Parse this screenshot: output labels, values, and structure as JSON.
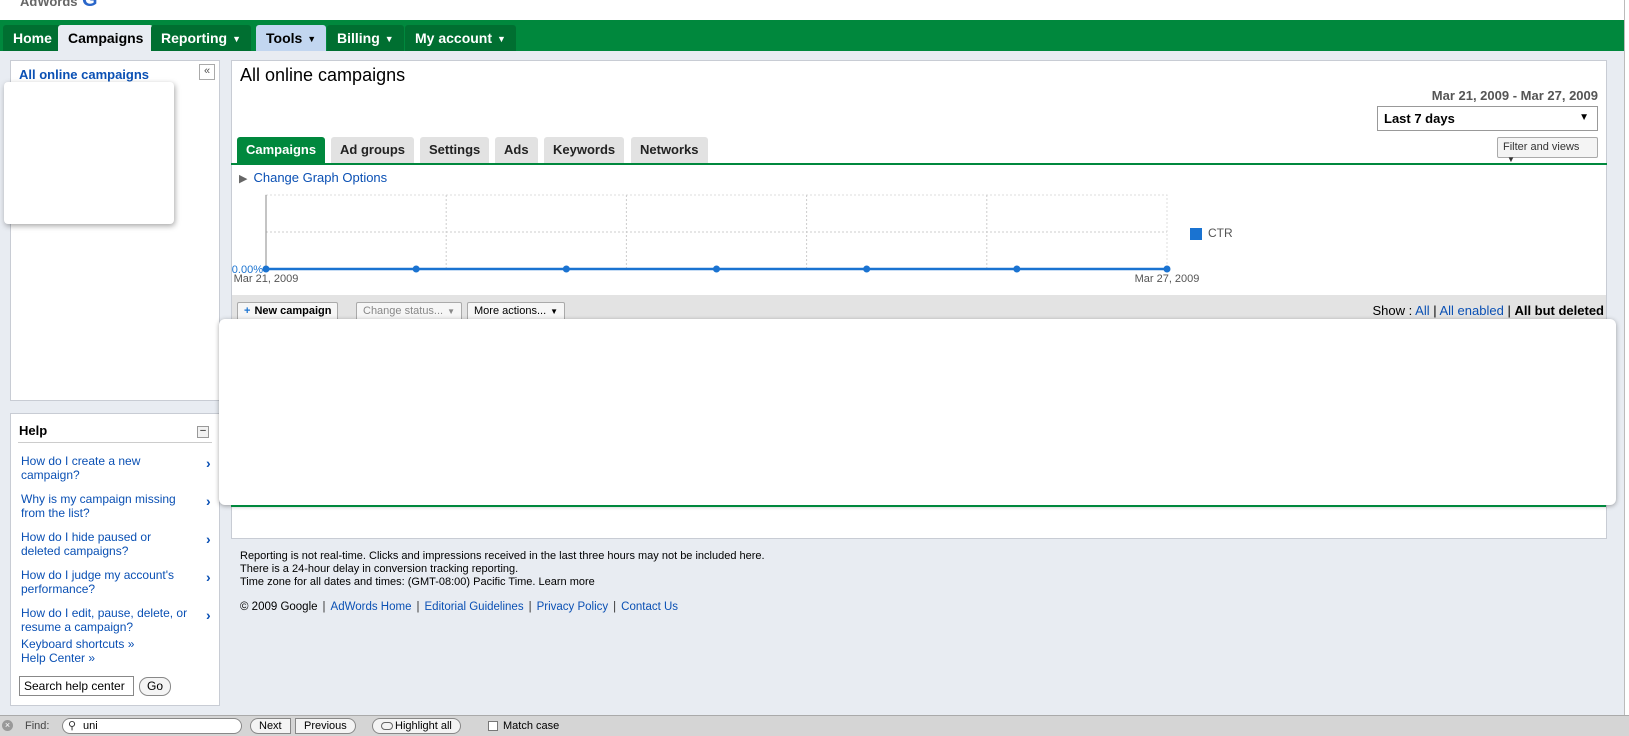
{
  "logo": {
    "text": "AdWords",
    "mark": "G"
  },
  "nav": {
    "tabs": [
      {
        "label": "Home"
      },
      {
        "label": "Campaigns"
      },
      {
        "label": "Reporting"
      },
      {
        "label": "Tools"
      },
      {
        "label": "Billing"
      },
      {
        "label": "My account"
      }
    ]
  },
  "sidebar": {
    "title": "All online campaigns",
    "collapse_label": "«"
  },
  "help": {
    "title": "Help",
    "minimize_label": "–",
    "questions": [
      "How do I create a new campaign?",
      "Why is my campaign missing from the list?",
      "How do I hide paused or deleted campaigns?",
      "How do I judge my account's performance?",
      "How do I edit, pause, delete, or resume a campaign?"
    ],
    "arrow": "›",
    "keyboard_link": "Keyboard shortcuts »",
    "center_link": "Help Center »",
    "search_value": "Search help center",
    "go_label": "Go"
  },
  "main": {
    "title": "All online campaigns",
    "date_range": "Mar 21, 2009 - Mar 27, 2009",
    "date_select": "Last 7 days",
    "filter_label": "Filter and views",
    "tabs": [
      {
        "label": "Campaigns"
      },
      {
        "label": "Ad groups"
      },
      {
        "label": "Settings"
      },
      {
        "label": "Ads"
      },
      {
        "label": "Keywords"
      },
      {
        "label": "Networks"
      }
    ],
    "graph_toggle": "Change Graph Options",
    "actions": {
      "new_campaign": "New campaign",
      "change_status": "Change status...",
      "more_actions": "More actions..."
    },
    "show": {
      "label": "Show :",
      "all": "All",
      "all_enabled": "All enabled",
      "all_but_deleted": "All but deleted"
    }
  },
  "chart_data": {
    "type": "line",
    "x": [
      "Mar 21, 2009",
      "Mar 22, 2009",
      "Mar 23, 2009",
      "Mar 24, 2009",
      "Mar 25, 2009",
      "Mar 26, 2009",
      "Mar 27, 2009"
    ],
    "x_tick_labels": [
      "Mar 21, 2009",
      "Mar 27, 2009"
    ],
    "y_tick_label": "0.00%",
    "series": [
      {
        "name": "CTR",
        "values": [
          0,
          0,
          0,
          0,
          0,
          0,
          0
        ],
        "color": "#1a73d1"
      }
    ],
    "grid": true,
    "legend": "right"
  },
  "notes": [
    "Reporting is not real-time. Clicks and impressions received in the last three hours may not be included here.",
    "There is a 24-hour delay in conversion tracking reporting.",
    "Time zone for all dates and times: (GMT-08:00) Pacific Time. Learn more"
  ],
  "footer": {
    "copyright": "© 2009 Google",
    "links": [
      "AdWords Home",
      "Editorial Guidelines",
      "Privacy Policy",
      "Contact Us"
    ]
  },
  "findbar": {
    "label": "Find:",
    "value": "uni",
    "next": "Next",
    "previous": "Previous",
    "highlight_all": "Highlight all",
    "match_case": "Match case"
  }
}
